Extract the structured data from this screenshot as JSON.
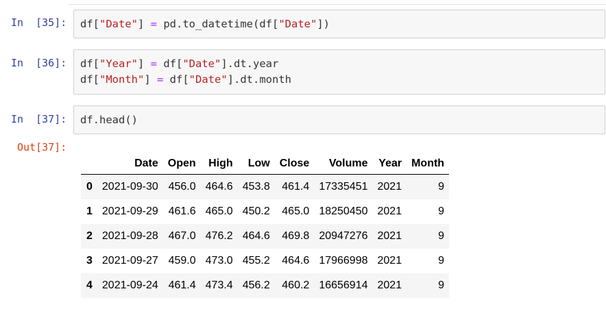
{
  "cells": [
    {
      "prompt": "In  [35]:",
      "lines": [
        [
          {
            "t": "df[",
            "c": ""
          },
          {
            "t": "\"Date\"",
            "c": "str"
          },
          {
            "t": "] ",
            "c": ""
          },
          {
            "t": "=",
            "c": "op"
          },
          {
            "t": " pd.to_datetime(df[",
            "c": ""
          },
          {
            "t": "\"Date\"",
            "c": "str"
          },
          {
            "t": "])",
            "c": ""
          }
        ]
      ]
    },
    {
      "prompt": "In  [36]:",
      "lines": [
        [
          {
            "t": "df[",
            "c": ""
          },
          {
            "t": "\"Year\"",
            "c": "str"
          },
          {
            "t": "] ",
            "c": ""
          },
          {
            "t": "=",
            "c": "op"
          },
          {
            "t": " df[",
            "c": ""
          },
          {
            "t": "\"Date\"",
            "c": "str"
          },
          {
            "t": "].dt.year",
            "c": ""
          }
        ],
        [
          {
            "t": "df[",
            "c": ""
          },
          {
            "t": "\"Month\"",
            "c": "str"
          },
          {
            "t": "] ",
            "c": ""
          },
          {
            "t": "=",
            "c": "op"
          },
          {
            "t": " df[",
            "c": ""
          },
          {
            "t": "\"Date\"",
            "c": "str"
          },
          {
            "t": "].dt.month",
            "c": ""
          }
        ]
      ]
    },
    {
      "prompt": "In  [37]:",
      "lines": [
        [
          {
            "t": "df.head()",
            "c": ""
          }
        ]
      ]
    }
  ],
  "output": {
    "prompt": "Out[37]:",
    "table": {
      "columns": [
        "Date",
        "Open",
        "High",
        "Low",
        "Close",
        "Volume",
        "Year",
        "Month"
      ],
      "rows": [
        {
          "index": "0",
          "values": [
            "2021-09-30",
            "456.0",
            "464.6",
            "453.8",
            "461.4",
            "17335451",
            "2021",
            "9"
          ]
        },
        {
          "index": "1",
          "values": [
            "2021-09-29",
            "461.6",
            "465.0",
            "450.2",
            "465.0",
            "18250450",
            "2021",
            "9"
          ]
        },
        {
          "index": "2",
          "values": [
            "2021-09-28",
            "467.0",
            "476.2",
            "464.6",
            "469.8",
            "20947276",
            "2021",
            "9"
          ]
        },
        {
          "index": "3",
          "values": [
            "2021-09-27",
            "459.0",
            "473.0",
            "455.2",
            "464.6",
            "17966998",
            "2021",
            "9"
          ]
        },
        {
          "index": "4",
          "values": [
            "2021-09-24",
            "461.4",
            "473.4",
            "456.2",
            "460.2",
            "16656914",
            "2021",
            "9"
          ]
        }
      ]
    }
  }
}
